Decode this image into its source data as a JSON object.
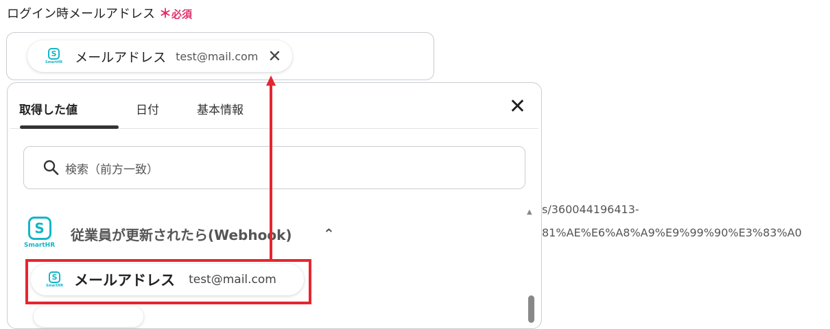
{
  "field": {
    "label": "ログイン時メールアドレス",
    "required_star": "＊",
    "required_text": "必須"
  },
  "selected_chip": {
    "app": "SmartHR",
    "name": "メールアドレス",
    "value": "test@mail.com",
    "remove": "✕"
  },
  "panel": {
    "tabs": [
      {
        "label": "取得した値"
      },
      {
        "label": "日付"
      },
      {
        "label": "基本情報"
      }
    ],
    "close": "✕",
    "search_placeholder": "検索（前方一致）",
    "group": {
      "app": "SmartHR",
      "title": "従業員が更新されたら(Webhook)",
      "chevron": "⌃"
    },
    "items": [
      {
        "app": "SmartHR",
        "name": "メールアドレス",
        "value": "test@mail.com"
      }
    ],
    "scroll_up": "▲"
  },
  "background_text": {
    "line1": "s/360044196413-",
    "line2": "81%AE%E6%A8%A9%E9%99%90%E3%83%A0"
  },
  "colors": {
    "accent_red": "#e5262f",
    "smarthr_teal": "#14b5c6",
    "required_pink": "#e0306a"
  }
}
